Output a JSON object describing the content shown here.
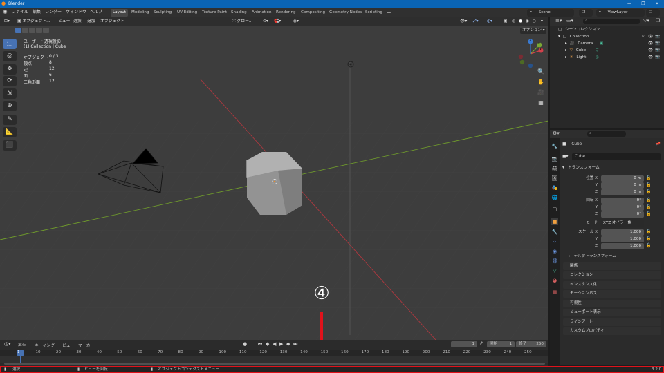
{
  "window": {
    "title": "Blender",
    "minimize": "—",
    "maximize": "❐",
    "close": "✕"
  },
  "menu": [
    "ファイル",
    "編集",
    "レンダー",
    "ウィンドウ",
    "ヘルプ"
  ],
  "workspaces": [
    "Layout",
    "Modeling",
    "Sculpting",
    "UV Editing",
    "Texture Paint",
    "Shading",
    "Animation",
    "Rendering",
    "Compositing",
    "Geometry Nodes",
    "Scripting"
  ],
  "workspace_add": "+",
  "scene": {
    "label": "Scene",
    "viewlayer": "ViewLayer"
  },
  "viewport_header": {
    "mode": "オブジェクト...",
    "menus": [
      "ビュー",
      "選択",
      "追加",
      "オブジェクト"
    ],
    "transform_orientation": "グロー...",
    "options": "オプション"
  },
  "viewport_info": {
    "view": "ユーザー・透視投影",
    "collection": "(1) Collection | Cube",
    "stats": [
      {
        "label": "オブジェクト",
        "value": "0 / 3"
      },
      {
        "label": "頂点",
        "value": "8"
      },
      {
        "label": "辺",
        "value": "12"
      },
      {
        "label": "面",
        "value": "6"
      },
      {
        "label": "三角形面",
        "value": "12"
      }
    ]
  },
  "gizmo": {
    "x": "X",
    "y": "Y",
    "z": "Z"
  },
  "outliner": {
    "root": "シーンコレクション",
    "collection": "Collection",
    "items": [
      "Camera",
      "Cube",
      "Light"
    ]
  },
  "properties": {
    "object_name": "Cube",
    "data_name": "Cube",
    "transform_title": "トランスフォーム",
    "location": {
      "label": "位置 X",
      "y": "Y",
      "z": "Z",
      "values": [
        "0 m",
        "0 m",
        "0 m"
      ]
    },
    "rotation": {
      "label": "回転 X",
      "y": "Y",
      "z": "Z",
      "values": [
        "0°",
        "0°",
        "0°"
      ]
    },
    "mode": {
      "label": "モード",
      "value": "XYZ オイラー角"
    },
    "scale": {
      "label": "スケール X",
      "y": "Y",
      "z": "Z",
      "values": [
        "1.000",
        "1.000",
        "1.000"
      ]
    },
    "delta": "デルタトランスフォーム",
    "panels": [
      "関係",
      "コレクション",
      "インスタンス化",
      "モーションパス",
      "可視性",
      "ビューポート表示",
      "ラインアート",
      "カスタムプロパティ"
    ]
  },
  "timeline": {
    "menus": [
      "再生",
      "キーイング",
      "ビュー",
      "マーカー"
    ],
    "current_frame": "1",
    "start_label": "開始",
    "start": "1",
    "end_label": "終了",
    "end": "250",
    "ticks": [
      "1",
      "10",
      "20",
      "30",
      "40",
      "50",
      "60",
      "70",
      "80",
      "90",
      "100",
      "110",
      "120",
      "130",
      "140",
      "150",
      "160",
      "170",
      "180",
      "190",
      "200",
      "210",
      "220",
      "230",
      "240",
      "250"
    ]
  },
  "statusbar": {
    "select": "選択",
    "rotate": "ビューを回転",
    "context": "オブジェクトコンテクストメニュー",
    "version": "3.2.0"
  },
  "annotation": {
    "number": "④"
  },
  "colors": {
    "accent": "#4772b3",
    "titlebar": "#0a64b4",
    "status_outline": "#e0121b",
    "x_axis": "#b0383f",
    "y_axis": "#6f9a2c"
  }
}
